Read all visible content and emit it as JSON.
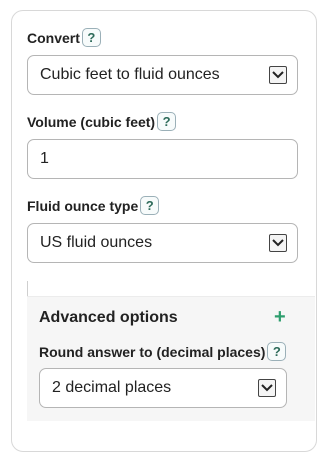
{
  "convert": {
    "label": "Convert",
    "help": "?",
    "selected": "Cubic feet to fluid ounces"
  },
  "volume": {
    "label": "Volume (cubic feet)",
    "help": "?",
    "value": "1"
  },
  "fluid_ounce_type": {
    "label": "Fluid ounce type",
    "help": "?",
    "selected": "US fluid ounces"
  },
  "advanced": {
    "title": "Advanced options",
    "toggle": "+",
    "round_label": "Round answer to (decimal places)",
    "round_help": "?",
    "round_selected": "2 decimal places"
  }
}
